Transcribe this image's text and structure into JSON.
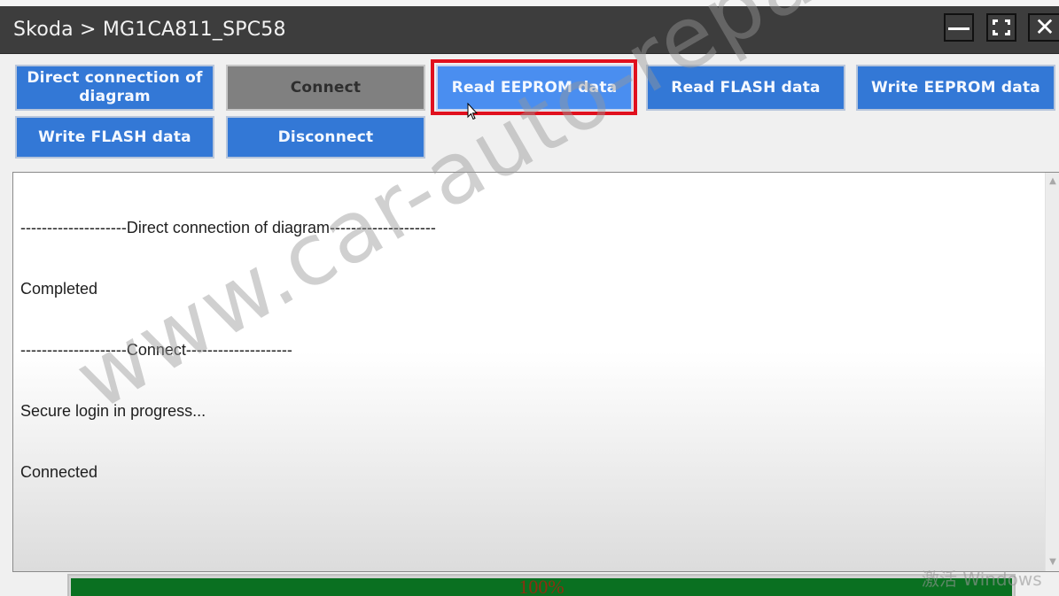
{
  "window": {
    "title": "Skoda > MG1CA811_SPC58",
    "controls": {
      "minimize": "minimize-icon",
      "maximize": "maximize-icon",
      "close": "close-icon",
      "close_glyph": "✕"
    }
  },
  "toolbar": {
    "buttons": [
      {
        "label": "Direct connection of diagram",
        "state": "normal"
      },
      {
        "label": "Connect",
        "state": "disabled"
      },
      {
        "label": "Read EEPROM data",
        "state": "hover-highlighted"
      },
      {
        "label": "Read FLASH data",
        "state": "normal"
      },
      {
        "label": "Write EEPROM data",
        "state": "normal"
      },
      {
        "label": "Write FLASH data",
        "state": "normal"
      },
      {
        "label": "Disconnect",
        "state": "normal"
      }
    ],
    "highlight_color": "#e0101e",
    "button_color": "#3378d6",
    "disabled_color": "#808080"
  },
  "log": {
    "lines": [
      "--------------------Direct connection of diagram--------------------",
      "Completed",
      "--------------------Connect--------------------",
      "Secure login in progress...",
      "Connected"
    ],
    "scroll_up_glyph": "▲",
    "scroll_down_glyph": "▼"
  },
  "progress": {
    "value_percent": 100,
    "label": "100%",
    "fill_color": "#0a7021"
  },
  "overlay": {
    "watermark": "www.car-auto-repair.com",
    "activation_text": "激活 Windows"
  }
}
